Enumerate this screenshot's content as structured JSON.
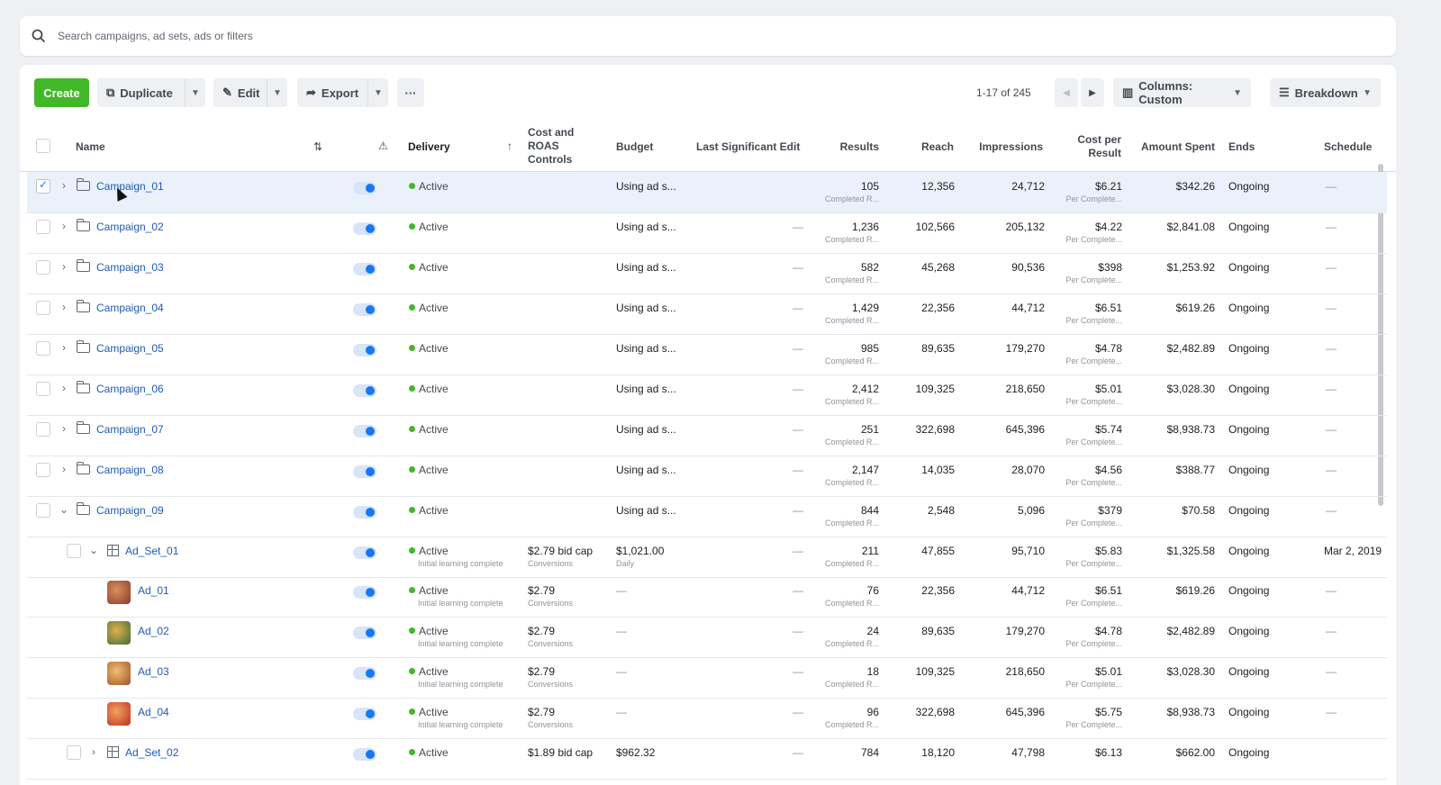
{
  "search": {
    "placeholder": "Search campaigns, ad sets, ads or filters"
  },
  "toolbar": {
    "create_label": "Create",
    "duplicate_label": "Duplicate",
    "edit_label": "Edit",
    "export_label": "Export",
    "more_label": "···",
    "pager_text": "1-17 of 245",
    "columns_label": "Columns: Custom",
    "breakdown_label": "Breakdown"
  },
  "header": {
    "name": "Name",
    "delivery": "Delivery",
    "cost_controls": "Cost and ROAS Controls",
    "budget": "Budget",
    "last_edit": "Last Significant Edit",
    "results": "Results",
    "reach": "Reach",
    "impressions": "Impressions",
    "cost_per_result": "Cost per Result",
    "amount_spent": "Amount Spent",
    "ends": "Ends",
    "schedule": "Schedule"
  },
  "colors": {
    "accent": "#1877f2",
    "create": "#42b72a",
    "active_dot": "#42b72a"
  },
  "rows": [
    {
      "name": "Campaign_01",
      "delivery": "Active",
      "cost": "",
      "cost_sub": "",
      "budget": "Using ad s...",
      "budget_sub": "",
      "last_edit": "",
      "results": "105",
      "results_sub": "Completed R...",
      "reach": "12,356",
      "impressions": "24,712",
      "cpr": "$6.21",
      "cpr_sub": "Per Complete...",
      "spent": "$342.26",
      "ends": "Ongoing",
      "schedule": "—"
    },
    {
      "name": "Campaign_02",
      "delivery": "Active",
      "cost": "",
      "cost_sub": "",
      "budget": "Using ad s...",
      "budget_sub": "",
      "last_edit": "—",
      "results": "1,236",
      "results_sub": "Completed R...",
      "reach": "102,566",
      "impressions": "205,132",
      "cpr": "$4.22",
      "cpr_sub": "Per Complete...",
      "spent": "$2,841.08",
      "ends": "Ongoing",
      "schedule": "—"
    },
    {
      "name": "Campaign_03",
      "delivery": "Active",
      "cost": "",
      "cost_sub": "",
      "budget": "Using ad s...",
      "budget_sub": "",
      "last_edit": "—",
      "results": "582",
      "results_sub": "Completed R...",
      "reach": "45,268",
      "impressions": "90,536",
      "cpr": "$398",
      "cpr_sub": "Per Complete...",
      "spent": "$1,253.92",
      "ends": "Ongoing",
      "schedule": "—"
    },
    {
      "name": "Campaign_04",
      "delivery": "Active",
      "cost": "",
      "cost_sub": "",
      "budget": "Using ad s...",
      "budget_sub": "",
      "last_edit": "—",
      "results": "1,429",
      "results_sub": "Completed R...",
      "reach": "22,356",
      "impressions": "44,712",
      "cpr": "$6.51",
      "cpr_sub": "Per Complete...",
      "spent": "$619.26",
      "ends": "Ongoing",
      "schedule": "—"
    },
    {
      "name": "Campaign_05",
      "delivery": "Active",
      "cost": "",
      "cost_sub": "",
      "budget": "Using ad s...",
      "budget_sub": "",
      "last_edit": "—",
      "results": "985",
      "results_sub": "Completed R...",
      "reach": "89,635",
      "impressions": "179,270",
      "cpr": "$4.78",
      "cpr_sub": "Per Complete...",
      "spent": "$2,482.89",
      "ends": "Ongoing",
      "schedule": "—"
    },
    {
      "name": "Campaign_06",
      "delivery": "Active",
      "cost": "",
      "cost_sub": "",
      "budget": "Using ad s...",
      "budget_sub": "",
      "last_edit": "—",
      "results": "2,412",
      "results_sub": "Completed R...",
      "reach": "109,325",
      "impressions": "218,650",
      "cpr": "$5.01",
      "cpr_sub": "Per Complete...",
      "spent": "$3,028.30",
      "ends": "Ongoing",
      "schedule": "—"
    },
    {
      "name": "Campaign_07",
      "delivery": "Active",
      "cost": "",
      "cost_sub": "",
      "budget": "Using ad s...",
      "budget_sub": "",
      "last_edit": "—",
      "results": "251",
      "results_sub": "Completed R...",
      "reach": "322,698",
      "impressions": "645,396",
      "cpr": "$5.74",
      "cpr_sub": "Per Complete...",
      "spent": "$8,938.73",
      "ends": "Ongoing",
      "schedule": "—"
    },
    {
      "name": "Campaign_08",
      "delivery": "Active",
      "cost": "",
      "cost_sub": "",
      "budget": "Using ad s...",
      "budget_sub": "",
      "last_edit": "—",
      "results": "2,147",
      "results_sub": "Completed R...",
      "reach": "14,035",
      "impressions": "28,070",
      "cpr": "$4.56",
      "cpr_sub": "Per Complete...",
      "spent": "$388.77",
      "ends": "Ongoing",
      "schedule": "—"
    },
    {
      "name": "Campaign_09",
      "delivery": "Active",
      "cost": "",
      "cost_sub": "",
      "budget": "Using ad s...",
      "budget_sub": "",
      "last_edit": "—",
      "results": "844",
      "results_sub": "Completed R...",
      "reach": "2,548",
      "impressions": "5,096",
      "cpr": "$379",
      "cpr_sub": "Per Complete...",
      "spent": "$70.58",
      "ends": "Ongoing",
      "schedule": "—"
    },
    {
      "name": "Ad_Set_01",
      "delivery": "Active",
      "delivery_sub": "Initial learning complete",
      "cost": "$2.79 bid cap",
      "cost_sub": "Conversions",
      "budget": "$1,021.00",
      "budget_sub": "Daily",
      "last_edit": "—",
      "results": "211",
      "results_sub": "Completed R...",
      "reach": "47,855",
      "impressions": "95,710",
      "cpr": "$5.83",
      "cpr_sub": "Per Complete...",
      "spent": "$1,325.58",
      "ends": "Ongoing",
      "schedule": "Mar 2, 2019"
    },
    {
      "name": "Ad_01",
      "delivery": "Active",
      "delivery_sub": "Initial learning complete",
      "cost": "$2.79",
      "cost_sub": "Conversions",
      "budget": "—",
      "budget_sub": "",
      "last_edit": "—",
      "results": "76",
      "results_sub": "Completed R...",
      "reach": "22,356",
      "impressions": "44,712",
      "cpr": "$6.51",
      "cpr_sub": "Per Complete...",
      "spent": "$619.26",
      "ends": "Ongoing",
      "schedule": "—"
    },
    {
      "name": "Ad_02",
      "delivery": "Active",
      "delivery_sub": "Initial learning complete",
      "cost": "$2.79",
      "cost_sub": "Conversions",
      "budget": "—",
      "budget_sub": "",
      "last_edit": "—",
      "results": "24",
      "results_sub": "Completed R...",
      "reach": "89,635",
      "impressions": "179,270",
      "cpr": "$4.78",
      "cpr_sub": "Per Complete...",
      "spent": "$2,482.89",
      "ends": "Ongoing",
      "schedule": "—"
    },
    {
      "name": "Ad_03",
      "delivery": "Active",
      "delivery_sub": "Initial learning complete",
      "cost": "$2.79",
      "cost_sub": "Conversions",
      "budget": "—",
      "budget_sub": "",
      "last_edit": "—",
      "results": "18",
      "results_sub": "Completed R...",
      "reach": "109,325",
      "impressions": "218,650",
      "cpr": "$5.01",
      "cpr_sub": "Per Complete...",
      "spent": "$3,028.30",
      "ends": "Ongoing",
      "schedule": "—"
    },
    {
      "name": "Ad_04",
      "delivery": "Active",
      "delivery_sub": "Initial learning complete",
      "cost": "$2.79",
      "cost_sub": "Conversions",
      "budget": "—",
      "budget_sub": "",
      "last_edit": "—",
      "results": "96",
      "results_sub": "Completed R...",
      "reach": "322,698",
      "impressions": "645,396",
      "cpr": "$5.75",
      "cpr_sub": "Per Complete...",
      "spent": "$8,938.73",
      "ends": "Ongoing",
      "schedule": "—"
    },
    {
      "name": "Ad_Set_02",
      "delivery": "Active",
      "delivery_sub": "",
      "cost": "$1.89 bid cap",
      "cost_sub": "",
      "budget": "$962.32",
      "budget_sub": "",
      "last_edit": "—",
      "results": "784",
      "results_sub": "",
      "reach": "18,120",
      "impressions": "47,798",
      "cpr": "$6.13",
      "cpr_sub": "",
      "spent": "$662.00",
      "ends": "Ongoing",
      "schedule": ""
    }
  ]
}
